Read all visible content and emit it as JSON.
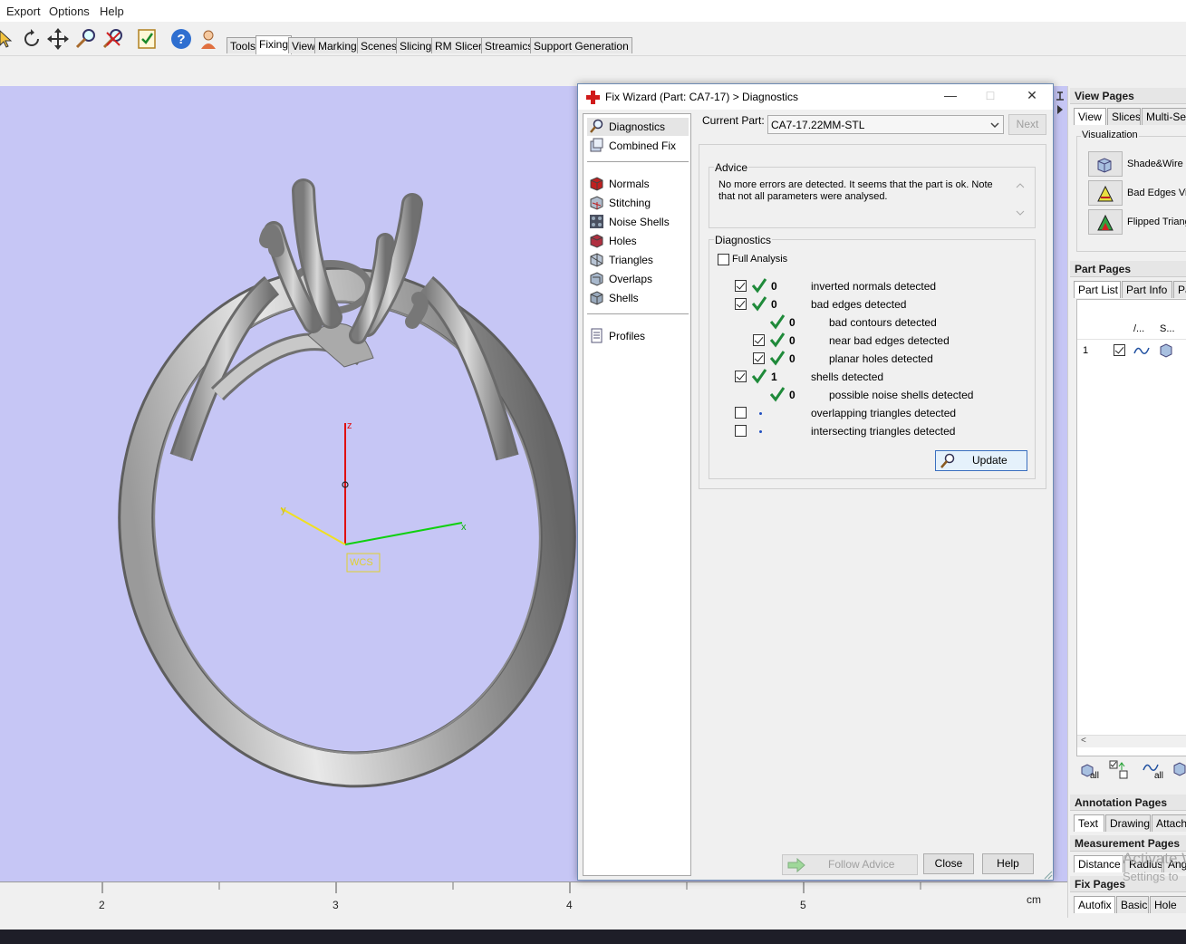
{
  "menubar": {
    "items": [
      "Export",
      "Options",
      "Help"
    ]
  },
  "toolbar": {
    "tabs": [
      "Tools",
      "Fixing",
      "View",
      "Marking",
      "Scenes",
      "Slicing",
      "RM Slicer",
      "Streamics",
      "Support Generation"
    ],
    "active_tab": "Fixing"
  },
  "viewport": {
    "axes": {
      "z": "z",
      "y": "y",
      "x": "x",
      "wcs": "WCS"
    },
    "ruler": {
      "ticks": [
        "2",
        "3",
        "4",
        "5"
      ],
      "unit": "cm"
    }
  },
  "dialog": {
    "title": "Fix Wizard (Part: CA7-17) > Diagnostics",
    "nav": {
      "top": [
        "Diagnostics",
        "Combined Fix"
      ],
      "middle": [
        "Normals",
        "Stitching",
        "Noise Shells",
        "Holes",
        "Triangles",
        "Overlaps",
        "Shells"
      ],
      "bottom": [
        "Profiles"
      ],
      "selected": "Diagnostics"
    },
    "current_part_label": "Current Part:",
    "current_part_value": "CA7-17.22MM-STL",
    "next_label": "Next",
    "advice_label": "Advice",
    "advice_text": "No more errors are detected. It seems that the part is ok. Note that not all parameters were analysed.",
    "diagnostics_label": "Diagnostics",
    "full_analysis_label": "Full Analysis",
    "rows": [
      {
        "checkbox": true,
        "checked": true,
        "status": "ok",
        "value": "0",
        "label": "inverted normals detected",
        "indent": 0
      },
      {
        "checkbox": true,
        "checked": true,
        "status": "ok",
        "value": "0",
        "label": "bad edges detected",
        "indent": 0
      },
      {
        "checkbox": false,
        "checked": false,
        "status": "ok",
        "value": "0",
        "label": "bad contours detected",
        "indent": 1
      },
      {
        "checkbox": true,
        "checked": true,
        "status": "ok",
        "value": "0",
        "label": "near bad edges detected",
        "indent": 1
      },
      {
        "checkbox": true,
        "checked": true,
        "status": "ok",
        "value": "0",
        "label": "planar holes detected",
        "indent": 1
      },
      {
        "checkbox": true,
        "checked": true,
        "status": "ok",
        "value": "1",
        "label": "shells detected",
        "indent": 0
      },
      {
        "checkbox": false,
        "checked": false,
        "status": "ok",
        "value": "0",
        "label": "possible noise shells detected",
        "indent": 1
      },
      {
        "checkbox": true,
        "checked": false,
        "status": "dot",
        "value": "",
        "label": "overlapping triangles detected",
        "indent": 0
      },
      {
        "checkbox": true,
        "checked": false,
        "status": "dot",
        "value": "",
        "label": "intersecting triangles detected",
        "indent": 0
      }
    ],
    "update_label": "Update",
    "follow_advice_label": "Follow Advice",
    "close_label": "Close",
    "help_label": "Help"
  },
  "right_panel": {
    "view_pages": {
      "title": "View Pages",
      "tabs": [
        "View",
        "Slices",
        "Multi-Sect"
      ],
      "visualization_label": "Visualization",
      "buttons": [
        "Shade&Wire",
        "Bad Edges Vis",
        "Flipped Triang"
      ]
    },
    "part_pages": {
      "title": "Part Pages",
      "tabs": [
        "Part List",
        "Part Info",
        "Pa"
      ],
      "columns": [
        "/...",
        "S..."
      ],
      "row_number": "1",
      "footer_labels": [
        "all",
        "all"
      ]
    },
    "annotation_pages": {
      "title": "Annotation Pages",
      "tabs": [
        "Text",
        "Drawing",
        "Attach"
      ]
    },
    "measurement_pages": {
      "title": "Measurement Pages",
      "tabs": [
        "Distance",
        "Radius",
        "Angl"
      ]
    },
    "fix_pages": {
      "title": "Fix Pages",
      "tabs": [
        "Autofix",
        "Basic",
        "Hole"
      ]
    },
    "watermark": [
      "Activate Win",
      "Settings to"
    ]
  }
}
